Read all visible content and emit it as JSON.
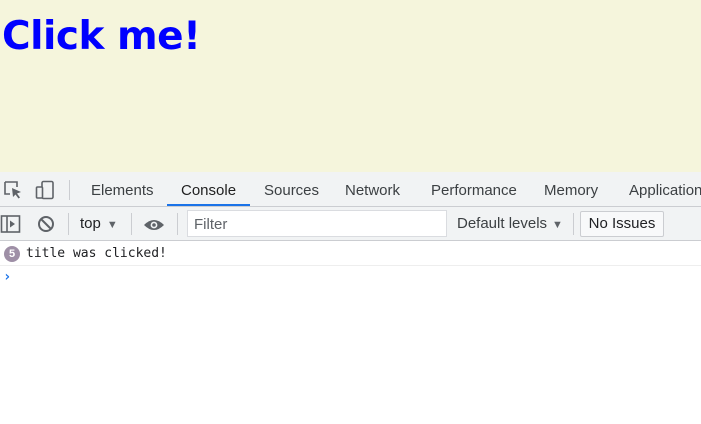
{
  "page": {
    "title": "Click me!",
    "background_color": "#f5f5dc",
    "title_color": "#0000ff"
  },
  "devtools": {
    "toolbar_icons": [
      "inspect-element-icon",
      "device-toolbar-icon"
    ],
    "tabs": [
      {
        "label": "Elements",
        "active": false
      },
      {
        "label": "Console",
        "active": true
      },
      {
        "label": "Sources",
        "active": false
      },
      {
        "label": "Network",
        "active": false
      },
      {
        "label": "Performance",
        "active": false
      },
      {
        "label": "Memory",
        "active": false
      },
      {
        "label": "Application",
        "active": false
      }
    ],
    "accent_color": "#1a73e8",
    "console_toolbar": {
      "sidebar_icon": "console-sidebar-icon",
      "clear_icon": "clear-console-icon",
      "context": "top",
      "eye_icon": "live-expression-icon",
      "filter_placeholder": "Filter",
      "filter_value": "",
      "levels_label": "Default levels",
      "issues_label": "No Issues"
    },
    "console": {
      "messages": [
        {
          "count": "5",
          "text": "title was clicked!"
        }
      ],
      "prompt_symbol": "›"
    }
  }
}
